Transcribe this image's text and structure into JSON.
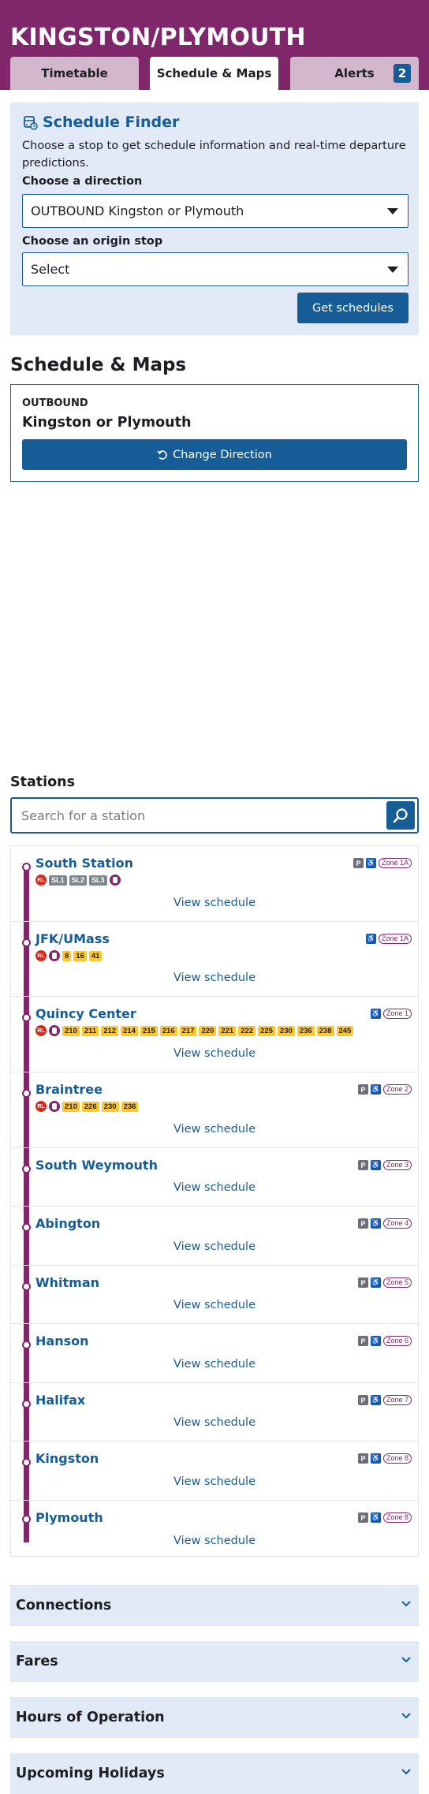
{
  "header": {
    "title": "KINGSTON/PLYMOUTH",
    "tabs": [
      {
        "label": "Timetable",
        "active": false
      },
      {
        "label": "Schedule & Maps",
        "active": true
      },
      {
        "label": "Alerts",
        "active": false,
        "badge": "2"
      }
    ]
  },
  "finder": {
    "title": "Schedule Finder",
    "icon": "schedule-finder-icon",
    "description": "Choose a stop to get schedule information and real-time departure predictions.",
    "direction_label": "Choose a direction",
    "direction_value": "OUTBOUND Kingston or Plymouth",
    "origin_label": "Choose an origin stop",
    "origin_value": "Select",
    "submit_label": "Get schedules"
  },
  "schedule_maps": {
    "title": "Schedule & Maps",
    "direction_label": "OUTBOUND",
    "destination": "Kingston or Plymouth",
    "change_direction_label": "Change Direction"
  },
  "stations": {
    "title": "Stations",
    "search_placeholder": "Search for a station",
    "view_schedule_label": "View schedule",
    "items": [
      {
        "name": "South Station",
        "parking": true,
        "accessible": true,
        "zone": "Zone 1A",
        "connections": {
          "red_line": true,
          "commuter_rail": true,
          "silver_line": [
            "SL1",
            "SL2",
            "SL3"
          ],
          "buses": []
        }
      },
      {
        "name": "JFK/UMass",
        "parking": false,
        "accessible": true,
        "zone": "Zone 1A",
        "connections": {
          "red_line": true,
          "commuter_rail": true,
          "silver_line": [],
          "buses": [
            "8",
            "16",
            "41"
          ]
        }
      },
      {
        "name": "Quincy Center",
        "parking": false,
        "accessible": true,
        "zone": "Zone 1",
        "connections": {
          "red_line": true,
          "commuter_rail": true,
          "silver_line": [],
          "buses": [
            "210",
            "211",
            "212",
            "214",
            "215",
            "216",
            "217",
            "220",
            "221",
            "222",
            "225",
            "230",
            "236",
            "238",
            "245"
          ]
        }
      },
      {
        "name": "Braintree",
        "parking": true,
        "accessible": true,
        "zone": "Zone 2",
        "connections": {
          "red_line": true,
          "commuter_rail": true,
          "silver_line": [],
          "buses": [
            "210",
            "226",
            "230",
            "236"
          ]
        }
      },
      {
        "name": "South Weymouth",
        "parking": true,
        "accessible": true,
        "zone": "Zone 3",
        "connections": null
      },
      {
        "name": "Abington",
        "parking": true,
        "accessible": true,
        "zone": "Zone 4",
        "connections": null
      },
      {
        "name": "Whitman",
        "parking": true,
        "accessible": true,
        "zone": "Zone 5",
        "connections": null
      },
      {
        "name": "Hanson",
        "parking": true,
        "accessible": true,
        "zone": "Zone 6",
        "connections": null
      },
      {
        "name": "Halifax",
        "parking": true,
        "accessible": true,
        "zone": "Zone 7",
        "connections": null
      },
      {
        "name": "Kingston",
        "parking": true,
        "accessible": true,
        "zone": "Zone 8",
        "connections": null
      },
      {
        "name": "Plymouth",
        "parking": true,
        "accessible": true,
        "zone": "Zone 8",
        "connections": null
      }
    ]
  },
  "accordions": [
    {
      "label": "Connections"
    },
    {
      "label": "Fares"
    },
    {
      "label": "Hours of Operation"
    },
    {
      "label": "Upcoming Holidays"
    }
  ],
  "colors": {
    "commuter_rail": "#80276c",
    "link_blue": "#165c96",
    "panel_bg": "#e1eaf6",
    "red_line": "#da291c",
    "bus_yellow": "#ffc72c",
    "silver_line": "#7c878e"
  }
}
